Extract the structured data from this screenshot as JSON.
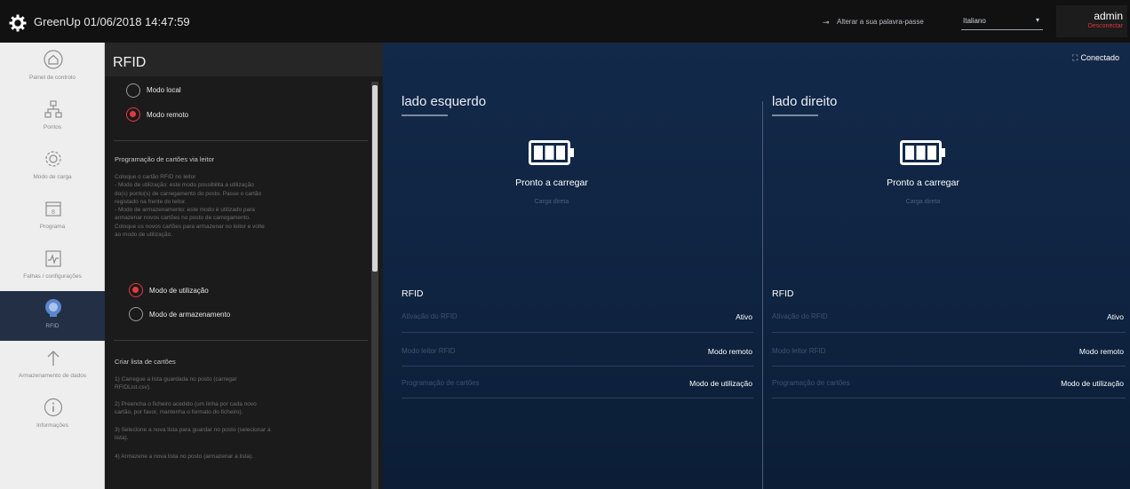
{
  "topbar": {
    "brand_prefix": "GreenUp",
    "brand_bold": "Up",
    "datetime": "01/06/2018 14:47:59",
    "language_link": "Alterar a sua palavra-passe",
    "select_value": "Italiano",
    "user_name": "admin",
    "logout_label": "Desconectar"
  },
  "nav": {
    "items": [
      {
        "label": "Painel de controlo",
        "icon": "home-icon"
      },
      {
        "label": "Pontos",
        "icon": "network-icon"
      },
      {
        "label": "Modo de carga",
        "icon": "gear-icon"
      },
      {
        "label": "Programa",
        "icon": "calendar-icon"
      },
      {
        "label": "Falhas / configurações",
        "icon": "chart-icon"
      },
      {
        "label": "RFID",
        "icon": "rfid-badge-icon"
      },
      {
        "label": "Armazenamento de dados",
        "icon": "upload-arrow-icon"
      },
      {
        "label": "Informações",
        "icon": "info-icon"
      }
    ]
  },
  "panel": {
    "title": "RFID",
    "radio_local": "Modo local",
    "radio_remote": "Modo remoto",
    "section_programming": "Programação de cartões via leitor",
    "programming_text": [
      "Coloque o cartão RFID no leitor",
      "- Modo de utilização: este modo possibilita a utilização",
      "do(s) ponto(s) de carregamento do posto. Passe o cartão",
      "registado na frente do leitor.",
      "- Modo de armazenamento: este modo é utilizado para",
      "armazenar novos cartões no posto de carregamento.",
      "Coloque os novos cartões para armazenar no leitor e volte",
      "ao modo de utilização."
    ],
    "radio_use": "Modo de utilização",
    "radio_store": "Modo de armazenamento",
    "section_list": "Criar lista de cartões",
    "list_steps": [
      [
        "1) Carregue a lista guardada no posto (carregar",
        "RFIDList.csv)."
      ],
      [
        "2) Preencha o ficheiro acedido (um linha por cada novo",
        "cartão, por favor, mantenha o formato do ficheiro)."
      ],
      [
        "3) Selecione a nova lista para guardar no posto (selecionar a",
        "lista)."
      ],
      [
        "4) Armazene a nova lista no posto (armazenar a lista)."
      ]
    ]
  },
  "main": {
    "connected_label": "Conectado",
    "left": {
      "title": "lado esquerdo",
      "state": "Pronto a carregar",
      "state_sub": "Carga direta",
      "rfid_title": "RFID",
      "rows": [
        {
          "label": "Ativação do RFID",
          "value": "Ativo"
        },
        {
          "label": "Modo leitor RFID",
          "value": "Modo remoto"
        },
        {
          "label": "Programação de cartões",
          "value": "Modo de utilização"
        }
      ]
    },
    "right": {
      "title": "lado direito",
      "state": "Pronto a carregar",
      "state_sub": "Carga direta",
      "rfid_title": "RFID",
      "rows": [
        {
          "label": "Ativação do RFID",
          "value": "Ativo"
        },
        {
          "label": "Modo leitor RFID",
          "value": "Modo remoto"
        },
        {
          "label": "Programação de cartões",
          "value": "Modo de utilização"
        }
      ]
    }
  },
  "colors": {
    "accent_red": "#e23a3f",
    "main_bg": "#13294a",
    "active_nav": "#222f45"
  }
}
